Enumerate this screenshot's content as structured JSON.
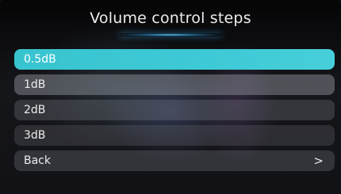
{
  "header": {
    "title": "Volume control steps"
  },
  "menu": {
    "items": [
      {
        "label": "0.5dB",
        "selected": true
      },
      {
        "label": "1dB",
        "selected": false
      },
      {
        "label": "2dB",
        "selected": false
      },
      {
        "label": "3dB",
        "selected": false
      },
      {
        "label": "Back",
        "selected": false,
        "icon": "chevron-right-icon"
      }
    ]
  },
  "icons": {
    "chevron": ">"
  },
  "colors": {
    "accent": "#3ec9d6",
    "text": "#ededed",
    "background": "#121216"
  }
}
